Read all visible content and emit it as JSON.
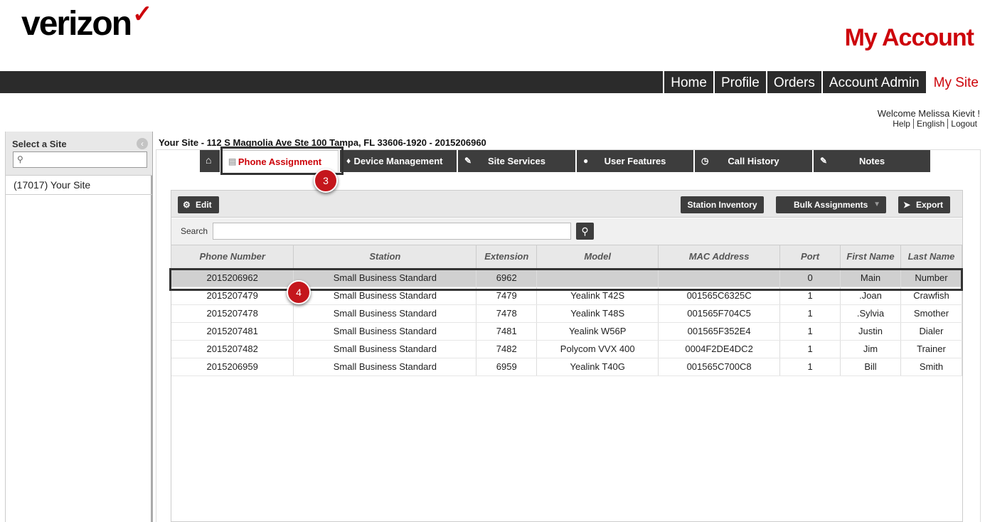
{
  "header": {
    "logo": "verizon",
    "logo_check": "✓",
    "title": "My Account"
  },
  "topnav": {
    "items": [
      "Home",
      "Profile",
      "Orders",
      "Account Admin",
      "My Site"
    ],
    "active": "My Site"
  },
  "user": {
    "welcome": "Welcome Melissa Kievit !",
    "links": [
      "Help",
      "English",
      "Logout"
    ]
  },
  "sidebar": {
    "title": "Select a Site",
    "search_placeholder": "",
    "sites": [
      "(17017) Your Site"
    ]
  },
  "site_title": "Your Site - 112 S Magnolia Ave Ste 100 Tampa, FL 33606-1920 - 2015206960",
  "tabs": [
    {
      "label": "",
      "icon": "home-icon"
    },
    {
      "label": "Phone Assignment",
      "icon": "document-icon",
      "active": true
    },
    {
      "label": "Device Management",
      "icon": "bell-icon"
    },
    {
      "label": "Site Services",
      "icon": "edit-icon"
    },
    {
      "label": "User Features",
      "icon": "user-icon"
    },
    {
      "label": "Call History",
      "icon": "clock-icon"
    },
    {
      "label": "Notes",
      "icon": "pencil-icon"
    }
  ],
  "annotations": {
    "step3": "3",
    "step4": "4"
  },
  "toolbar": {
    "edit": "Edit",
    "station_inventory": "Station Inventory",
    "bulk_assignments": "Bulk Assignments",
    "export": "Export"
  },
  "search": {
    "label": "Search",
    "value": ""
  },
  "table": {
    "columns": [
      "Phone Number",
      "Station",
      "Extension",
      "Model",
      "MAC Address",
      "Port",
      "First Name",
      "Last Name"
    ],
    "rows": [
      [
        "2015206962",
        "Small Business Standard",
        "6962",
        "",
        "",
        "0",
        "Main",
        "Number"
      ],
      [
        "2015207479",
        "Small Business Standard",
        "7479",
        "Yealink T42S",
        "001565C6325C",
        "1",
        ".Joan",
        "Crawfish"
      ],
      [
        "2015207478",
        "Small Business Standard",
        "7478",
        "Yealink T48S",
        "001565F704C5",
        "1",
        ".Sylvia",
        "Smother"
      ],
      [
        "2015207481",
        "Small Business Standard",
        "7481",
        "Yealink W56P",
        "001565F352E4",
        "1",
        "Justin",
        "Dialer"
      ],
      [
        "2015207482",
        "Small Business Standard",
        "7482",
        "Polycom VVX 400",
        "0004F2DE4DC2",
        "1",
        "Jim",
        "Trainer"
      ],
      [
        "2015206959",
        "Small Business Standard",
        "6959",
        "Yealink T40G",
        "001565C700C8",
        "1",
        "Bill",
        "Smith"
      ]
    ],
    "selected_row": 0
  },
  "colors": {
    "brand_red": "#cd040b",
    "dark_bar": "#2b2b2b",
    "button": "#3d3d3d"
  }
}
